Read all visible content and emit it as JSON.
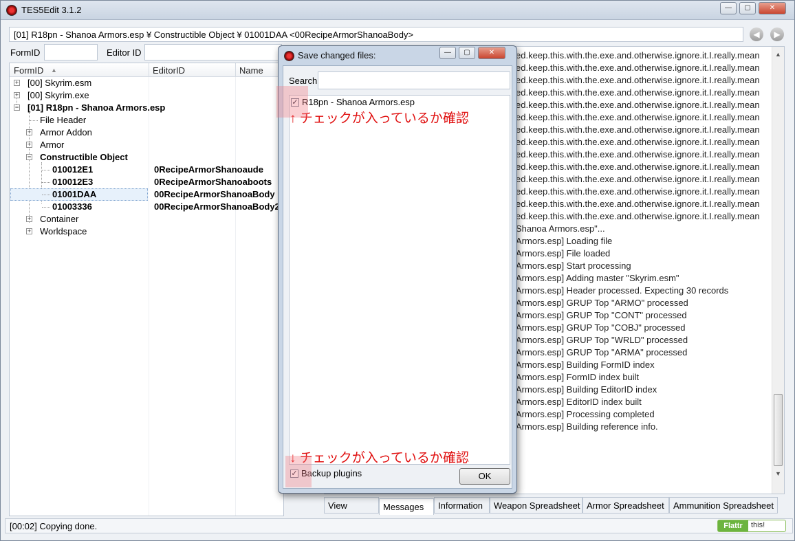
{
  "window": {
    "title": "TES5Edit 3.1.2",
    "minimize": "—",
    "maximize": "▢",
    "close": "✕"
  },
  "pathbar": {
    "text": "[01] R18pn - Shanoa Armors.esp ¥ Constructible Object ¥ 01001DAA <00RecipeArmorShanoaBody>"
  },
  "nav": {
    "back": "◀",
    "forward": "▶"
  },
  "filters": {
    "formid_label": "FormID",
    "editorid_label": "Editor ID"
  },
  "tree": {
    "columns": [
      "FormID",
      "EditorID",
      "Name"
    ],
    "sort_indicator": "▲",
    "rows": [
      {
        "label": "[00] Skyrim.esm",
        "editor": "",
        "expander": "+"
      },
      {
        "label": "[00] Skyrim.exe",
        "editor": "",
        "expander": "+"
      },
      {
        "label": "[01] R18pn - Shanoa Armors.esp",
        "editor": "",
        "expander": "−"
      },
      {
        "label": "File Header",
        "editor": "",
        "expander": ""
      },
      {
        "label": "Armor Addon",
        "editor": "",
        "expander": "+"
      },
      {
        "label": "Armor",
        "editor": "",
        "expander": "+"
      },
      {
        "label": "Constructible Object",
        "editor": "",
        "expander": "−"
      },
      {
        "label": "010012E1",
        "editor": "0RecipeArmorShanoaude",
        "expander": ""
      },
      {
        "label": "010012E3",
        "editor": "0RecipeArmorShanoaboots",
        "expander": ""
      },
      {
        "label": "01001DAA",
        "editor": "00RecipeArmorShanoaBody",
        "expander": ""
      },
      {
        "label": "01003336",
        "editor": "00RecipeArmorShanoaBody2",
        "expander": ""
      },
      {
        "label": "Container",
        "editor": "",
        "expander": "+"
      },
      {
        "label": "Worldspace",
        "editor": "",
        "expander": "+"
      }
    ]
  },
  "messages": {
    "lines": [
      "ed.keep.this.with.the.exe.and.otherwise.ignore.it.I.really.mean",
      "ed.keep.this.with.the.exe.and.otherwise.ignore.it.I.really.mean",
      "ed.keep.this.with.the.exe.and.otherwise.ignore.it.I.really.mean",
      "ed.keep.this.with.the.exe.and.otherwise.ignore.it.I.really.mean",
      "ed.keep.this.with.the.exe.and.otherwise.ignore.it.I.really.mean",
      "ed.keep.this.with.the.exe.and.otherwise.ignore.it.I.really.mean",
      "ed.keep.this.with.the.exe.and.otherwise.ignore.it.I.really.mean",
      "ed.keep.this.with.the.exe.and.otherwise.ignore.it.I.really.mean",
      "ed.keep.this.with.the.exe.and.otherwise.ignore.it.I.really.mean",
      "ed.keep.this.with.the.exe.and.otherwise.ignore.it.I.really.mean",
      "ed.keep.this.with.the.exe.and.otherwise.ignore.it.I.really.mean",
      "ed.keep.this.with.the.exe.and.otherwise.ignore.it.I.really.mean",
      "ed.keep.this.with.the.exe.and.otherwise.ignore.it.I.really.mean",
      "ed.keep.this.with.the.exe.and.otherwise.ignore.it.I.really.mean",
      "Shanoa Armors.esp\"...",
      "Armors.esp] Loading file",
      "Armors.esp] File loaded",
      "Armors.esp] Start processing",
      "Armors.esp] Adding master \"Skyrim.esm\"",
      "Armors.esp] Header processed. Expecting 30 records",
      "Armors.esp] GRUP Top \"ARMO\" processed",
      "Armors.esp] GRUP Top \"CONT\" processed",
      "Armors.esp] GRUP Top \"COBJ\" processed",
      "Armors.esp] GRUP Top \"WRLD\" processed",
      "Armors.esp] GRUP Top \"ARMA\" processed",
      "Armors.esp] Building FormID index",
      "Armors.esp] FormID index built",
      "Armors.esp] Building EditorID index",
      "Armors.esp] EditorID index built",
      "Armors.esp] Processing completed",
      "Armors.esp] Building reference info."
    ]
  },
  "tabs": [
    "View",
    "Messages",
    "Information",
    "Weapon Spreadsheet",
    "Armor Spreadsheet",
    "Ammunition Spreadsheet"
  ],
  "active_tab": "Messages",
  "status": {
    "text": "[00:02] Copying done."
  },
  "flattr": {
    "left": "Flattr",
    "right": "this!"
  },
  "dialog": {
    "title": "Save changed files:",
    "search_label": "Search",
    "file": "R18pn - Shanoa Armors.esp",
    "file_checked": "✓",
    "note_top": "↑ チェックが入っているか確認",
    "note_bottom": "↓ チェックが入っているか確認",
    "backup_label": "Backup plugins",
    "backup_checked": "✓",
    "ok": "OK"
  },
  "colors": {
    "accent_red": "#e01010",
    "highlight_pink": "#f07882"
  }
}
